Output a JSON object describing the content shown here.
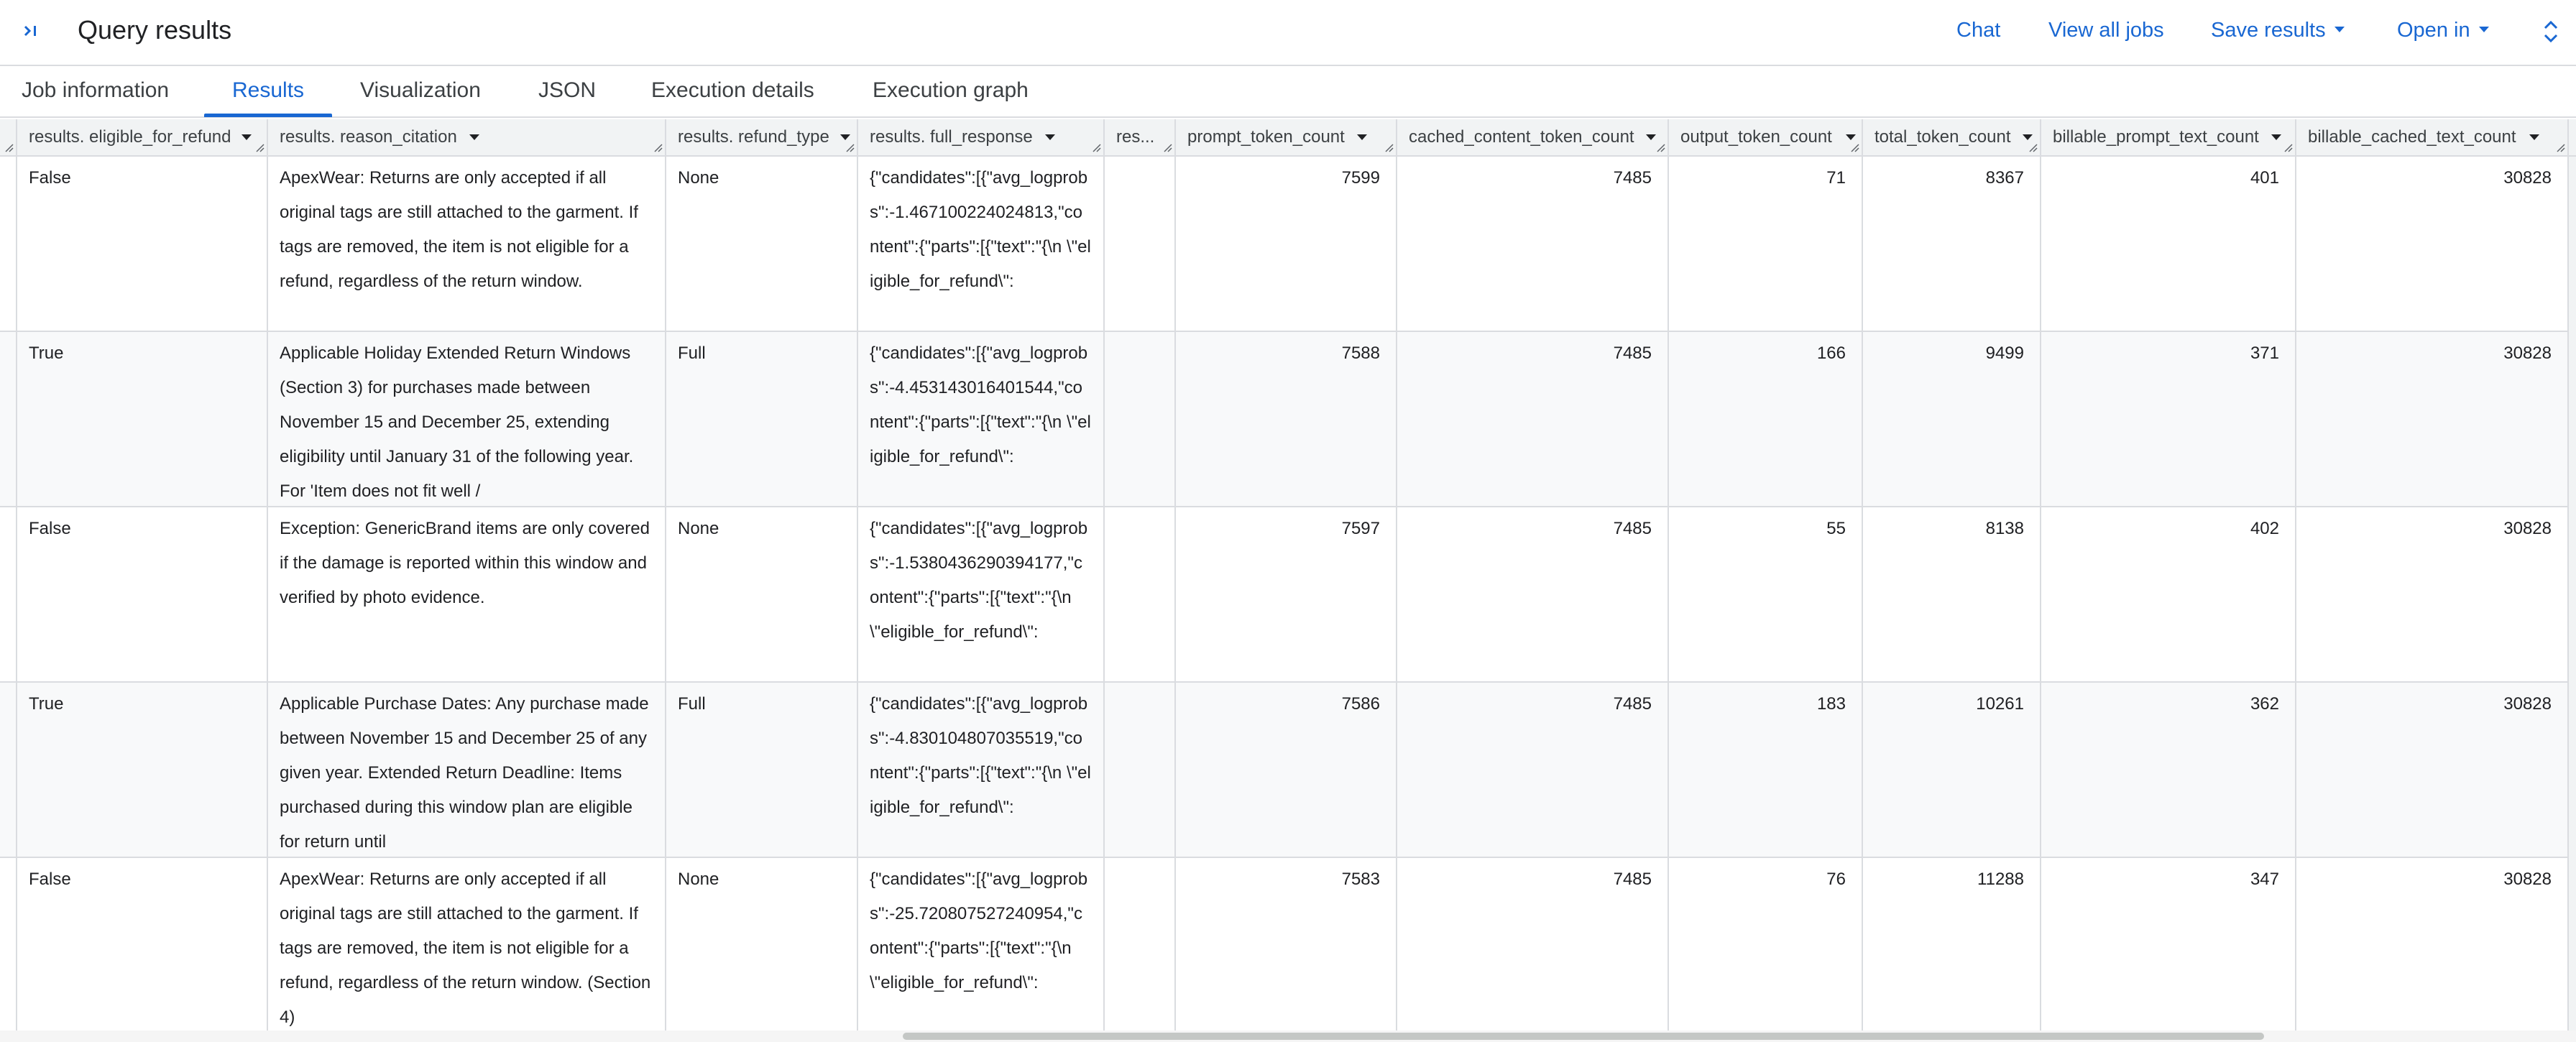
{
  "header": {
    "title": "Query results",
    "actions": {
      "chat": "Chat",
      "view_all_jobs": "View all jobs",
      "save_results": "Save results",
      "open_in": "Open in"
    }
  },
  "tabs": [
    {
      "label": "Job information"
    },
    {
      "label": "Results",
      "active": true
    },
    {
      "label": "Visualization"
    },
    {
      "label": "JSON"
    },
    {
      "label": "Execution details"
    },
    {
      "label": "Execution graph"
    }
  ],
  "accent_color": "#1967d2",
  "table": {
    "columns": [
      "results. eligible_for_refund",
      "results. reason_citation",
      "results. refund_type",
      "results. full_response",
      "res...",
      "prompt_token_count",
      "cached_content_token_count",
      "output_token_count",
      "total_token_count",
      "billable_prompt_text_count",
      "billable_cached_text_count"
    ],
    "rows": [
      {
        "eligible": "False",
        "reason": "ApexWear: Returns are only accepted if all original tags are still attached to the garment. If tags are removed, the item is not eligible for a refund, regardless of the return window.",
        "refund_type": "None",
        "response": "{\"candidates\":[{\"avg_logprobs\":-1.467100224024813,\"content\":{\"parts\":[{\"text\":\"{\\n \\\"eligible_for_refund\\\":",
        "res": "",
        "prompt": "7599",
        "cached": "7485",
        "output": "71",
        "total": "8367",
        "billable_prompt": "401",
        "billable_cached": "30828"
      },
      {
        "eligible": "True",
        "reason": "Applicable Holiday Extended Return Windows (Section 3) for purchases made between November 15 and December 25, extending eligibility until January 31 of the following year. For 'Item does not fit well /",
        "refund_type": "Full",
        "response": "{\"candidates\":[{\"avg_logprobs\":-4.453143016401544,\"content\":{\"parts\":[{\"text\":\"{\\n \\\"eligible_for_refund\\\":",
        "res": "",
        "prompt": "7588",
        "cached": "7485",
        "output": "166",
        "total": "9499",
        "billable_prompt": "371",
        "billable_cached": "30828"
      },
      {
        "eligible": "False",
        "reason": "Exception: GenericBrand items are only covered if the damage is reported within this window and verified by photo evidence.",
        "refund_type": "None",
        "response": "{\"candidates\":[{\"avg_logprobs\":-1.5380436290394177,\"content\":{\"parts\":[{\"text\":\"{\\n \\\"eligible_for_refund\\\":",
        "res": "",
        "prompt": "7597",
        "cached": "7485",
        "output": "55",
        "total": "8138",
        "billable_prompt": "402",
        "billable_cached": "30828"
      },
      {
        "eligible": "True",
        "reason": "Applicable Purchase Dates: Any purchase made between November 15 and December 25 of any given year. Extended Return Deadline: Items purchased during this window plan are eligible for return until",
        "refund_type": "Full",
        "response": "{\"candidates\":[{\"avg_logprobs\":-4.830104807035519,\"content\":{\"parts\":[{\"text\":\"{\\n \\\"eligible_for_refund\\\":",
        "res": "",
        "prompt": "7586",
        "cached": "7485",
        "output": "183",
        "total": "10261",
        "billable_prompt": "362",
        "billable_cached": "30828"
      },
      {
        "eligible": "False",
        "reason": "ApexWear: Returns are only accepted if all original tags are still attached to the garment. If tags are removed, the item is not eligible for a refund, regardless of the return window. (Section 4)",
        "refund_type": "None",
        "response": "{\"candidates\":[{\"avg_logprobs\":-25.720807527240954,\"content\":{\"parts\":[{\"text\":\"{\\n \\\"eligible_for_refund\\\":",
        "res": "",
        "prompt": "7583",
        "cached": "7485",
        "output": "76",
        "total": "11288",
        "billable_prompt": "347",
        "billable_cached": "30828"
      }
    ]
  }
}
